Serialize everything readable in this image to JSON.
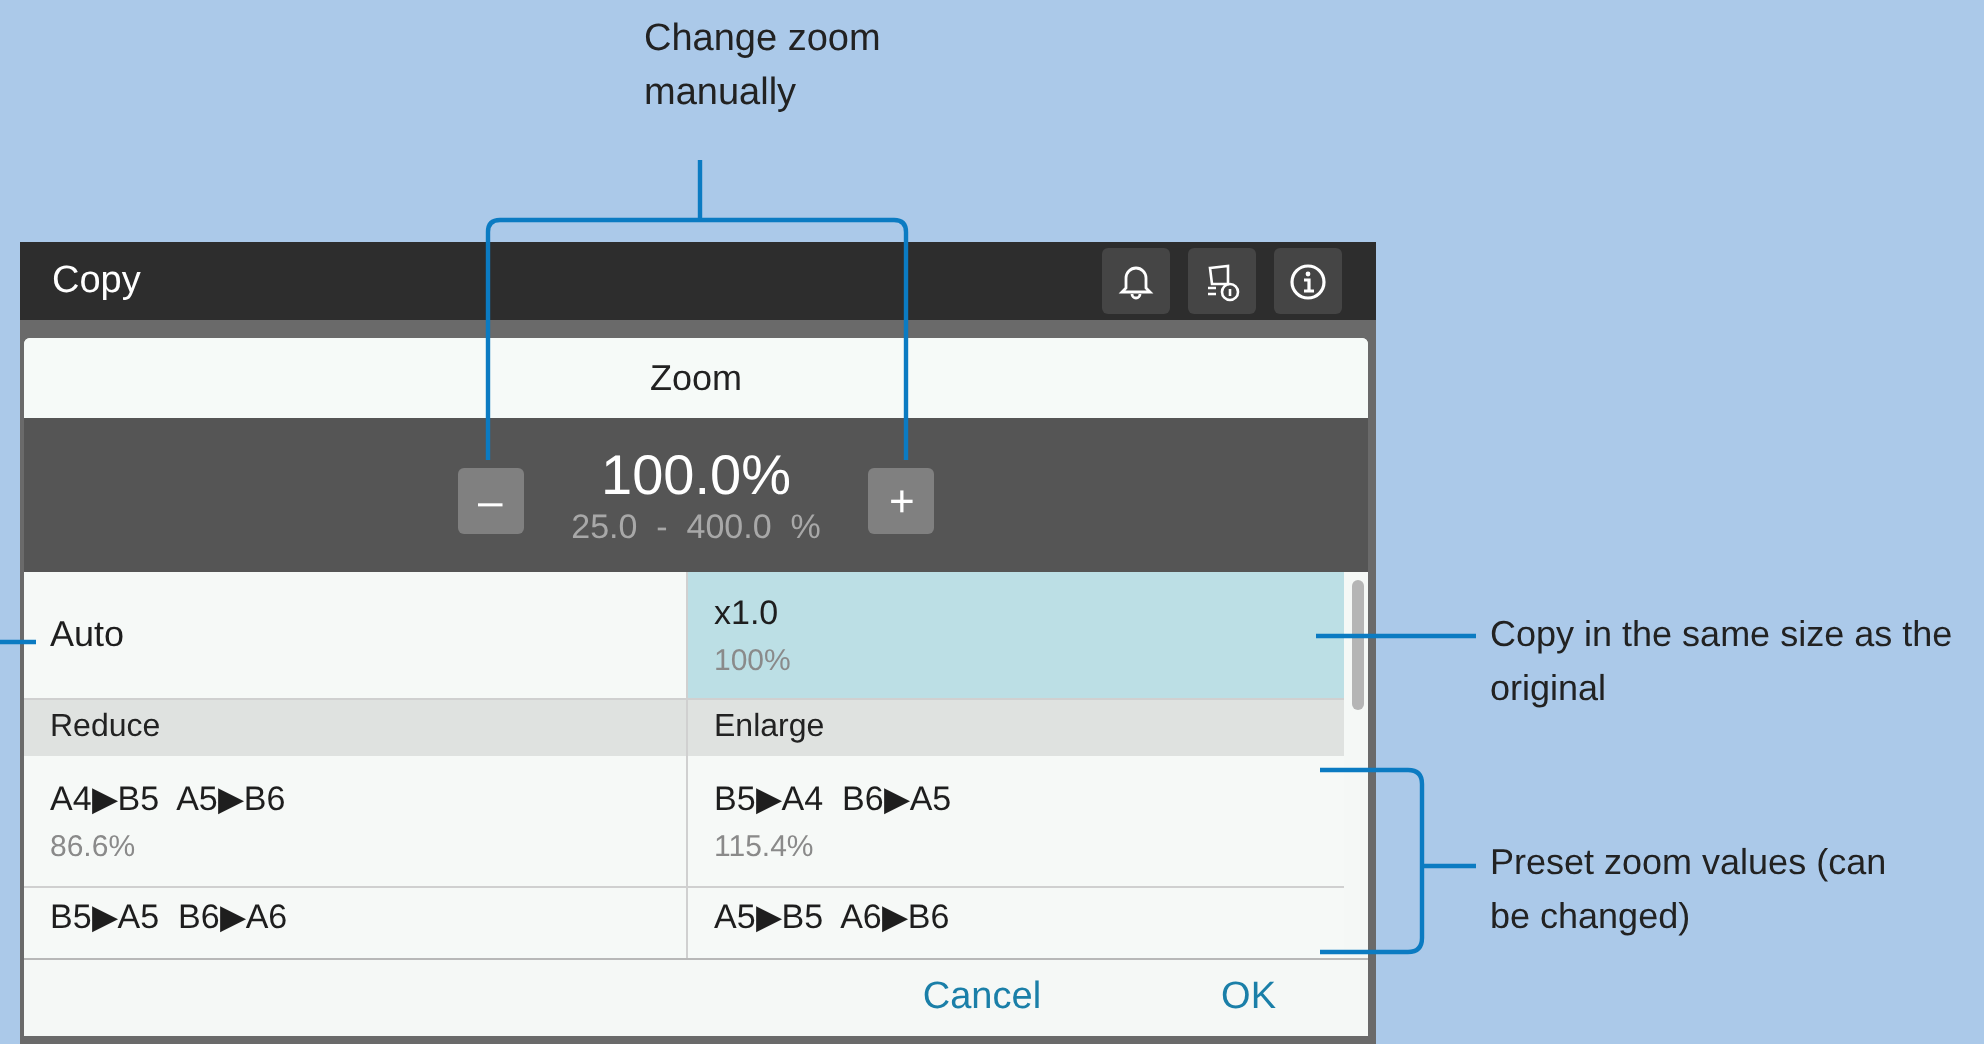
{
  "callouts": [
    {
      "kind": "top",
      "text": "Change zoom manually"
    },
    {
      "kind": "same-size",
      "text": "Copy in the same size as the original"
    },
    {
      "kind": "presets",
      "text": "Preset zoom values (can be changed)"
    }
  ],
  "screen": {
    "title": "Copy",
    "toolbar_icons": [
      {
        "kind": "bell"
      },
      {
        "kind": "device-info"
      },
      {
        "kind": "info"
      }
    ]
  },
  "dialog": {
    "title": "Zoom",
    "minus": "–",
    "plus": "+",
    "value": "100.0%",
    "range": "25.0  -  400.0  %",
    "options": [
      {
        "label": "Auto",
        "selected": false
      },
      {
        "label": "x1.0",
        "value": "100%",
        "selected": true
      }
    ],
    "columns": [
      {
        "heading": "Reduce",
        "presets": [
          {
            "label": "A4▶B5  A5▶B6",
            "value": "86.6%"
          },
          {
            "label": "B5▶A5  B6▶A6"
          }
        ]
      },
      {
        "heading": "Enlarge",
        "presets": [
          {
            "label": "B5▶A4  B6▶A5",
            "value": "115.4%"
          },
          {
            "label": "A5▶B5  A6▶B6"
          }
        ]
      }
    ],
    "buttons": [
      "Cancel",
      "OK"
    ]
  }
}
